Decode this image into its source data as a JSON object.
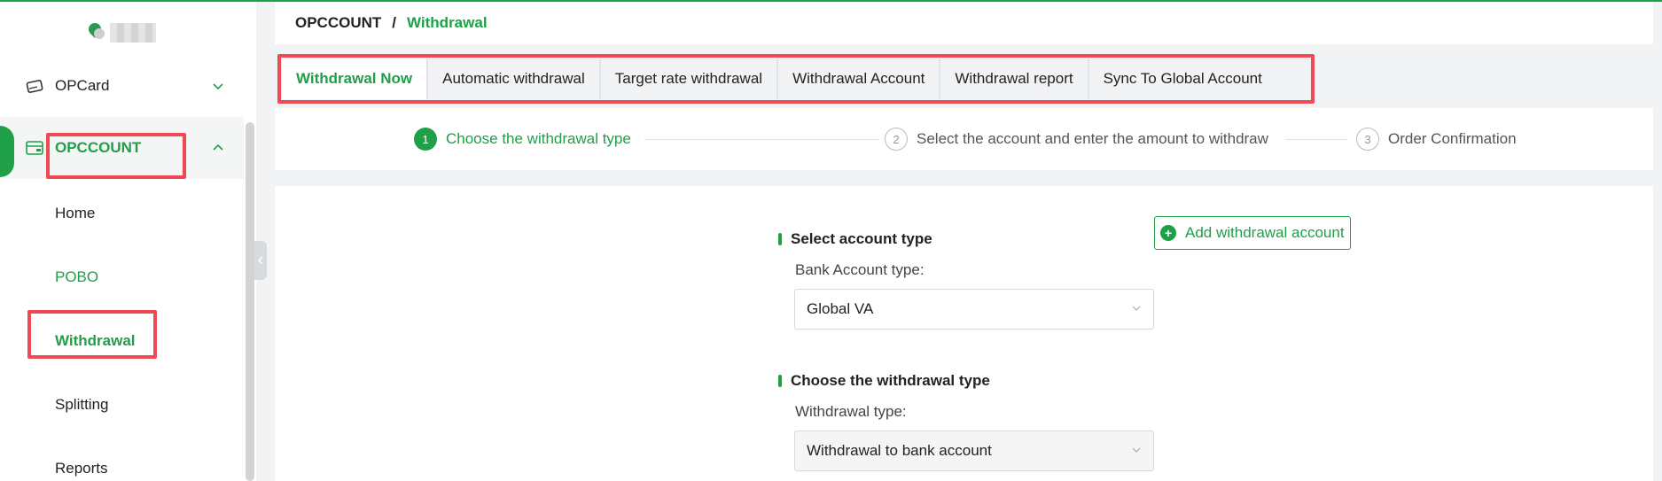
{
  "sidebar": {
    "menu": [
      {
        "label": "OPCard"
      },
      {
        "label": "OPCCOUNT"
      }
    ],
    "submenu": [
      "Home",
      "POBO",
      "Withdrawal",
      "Splitting",
      "Reports"
    ]
  },
  "breadcrumb": {
    "parent": "OPCCOUNT",
    "separator": "/",
    "current": "Withdrawal"
  },
  "tabs": [
    {
      "label": "Withdrawal Now",
      "active": true
    },
    {
      "label": "Automatic withdrawal"
    },
    {
      "label": "Target rate withdrawal"
    },
    {
      "label": "Withdrawal Account"
    },
    {
      "label": "Withdrawal report"
    },
    {
      "label": "Sync To Global Account"
    }
  ],
  "steps": [
    {
      "num": "1",
      "label": "Choose the withdrawal type"
    },
    {
      "num": "2",
      "label": "Select the account and enter the amount to withdraw"
    },
    {
      "num": "3",
      "label": "Order Confirmation"
    }
  ],
  "form": {
    "section1_title": "Select account type",
    "bank_type_label": "Bank Account type:",
    "bank_type_value": "Global VA",
    "section2_title": "Choose the withdrawal type",
    "withdrawal_type_label": "Withdrawal type:",
    "withdrawal_type_value": "Withdrawal to bank account",
    "add_account_label": "Add withdrawal account"
  },
  "colors": {
    "accent": "#1f9f48",
    "highlight": "#ee4a55"
  }
}
